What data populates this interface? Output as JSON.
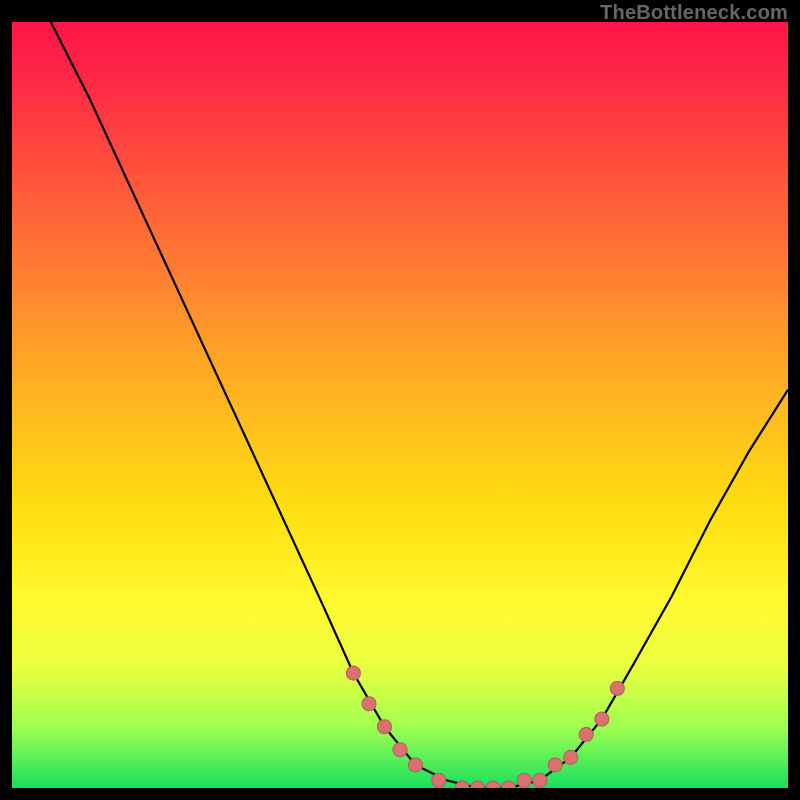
{
  "source_label": "TheBottleneck.com",
  "chart_data": {
    "type": "line",
    "title": "",
    "xlabel": "",
    "ylabel": "",
    "xlim": [
      0,
      100
    ],
    "ylim": [
      0,
      100
    ],
    "curve": [
      {
        "x": 5,
        "y": 100
      },
      {
        "x": 10,
        "y": 90
      },
      {
        "x": 15,
        "y": 79
      },
      {
        "x": 20,
        "y": 68
      },
      {
        "x": 25,
        "y": 57
      },
      {
        "x": 30,
        "y": 46
      },
      {
        "x": 35,
        "y": 35
      },
      {
        "x": 40,
        "y": 24
      },
      {
        "x": 44,
        "y": 15
      },
      {
        "x": 48,
        "y": 8
      },
      {
        "x": 52,
        "y": 3
      },
      {
        "x": 56,
        "y": 1
      },
      {
        "x": 60,
        "y": 0
      },
      {
        "x": 64,
        "y": 0
      },
      {
        "x": 68,
        "y": 1
      },
      {
        "x": 72,
        "y": 4
      },
      {
        "x": 76,
        "y": 9
      },
      {
        "x": 80,
        "y": 16
      },
      {
        "x": 85,
        "y": 25
      },
      {
        "x": 90,
        "y": 35
      },
      {
        "x": 95,
        "y": 44
      },
      {
        "x": 100,
        "y": 52
      }
    ],
    "markers": [
      {
        "x": 44,
        "y": 15
      },
      {
        "x": 46,
        "y": 11
      },
      {
        "x": 48,
        "y": 8
      },
      {
        "x": 50,
        "y": 5
      },
      {
        "x": 52,
        "y": 3
      },
      {
        "x": 55,
        "y": 1
      },
      {
        "x": 58,
        "y": 0
      },
      {
        "x": 60,
        "y": 0
      },
      {
        "x": 62,
        "y": 0
      },
      {
        "x": 64,
        "y": 0
      },
      {
        "x": 66,
        "y": 1
      },
      {
        "x": 68,
        "y": 1
      },
      {
        "x": 70,
        "y": 3
      },
      {
        "x": 72,
        "y": 4
      },
      {
        "x": 74,
        "y": 7
      },
      {
        "x": 76,
        "y": 9
      },
      {
        "x": 78,
        "y": 13
      }
    ],
    "gradient_stops": [
      {
        "pos": 0,
        "color": "#ff1447"
      },
      {
        "pos": 50,
        "color": "#ffb820"
      },
      {
        "pos": 100,
        "color": "#17e060"
      }
    ]
  }
}
